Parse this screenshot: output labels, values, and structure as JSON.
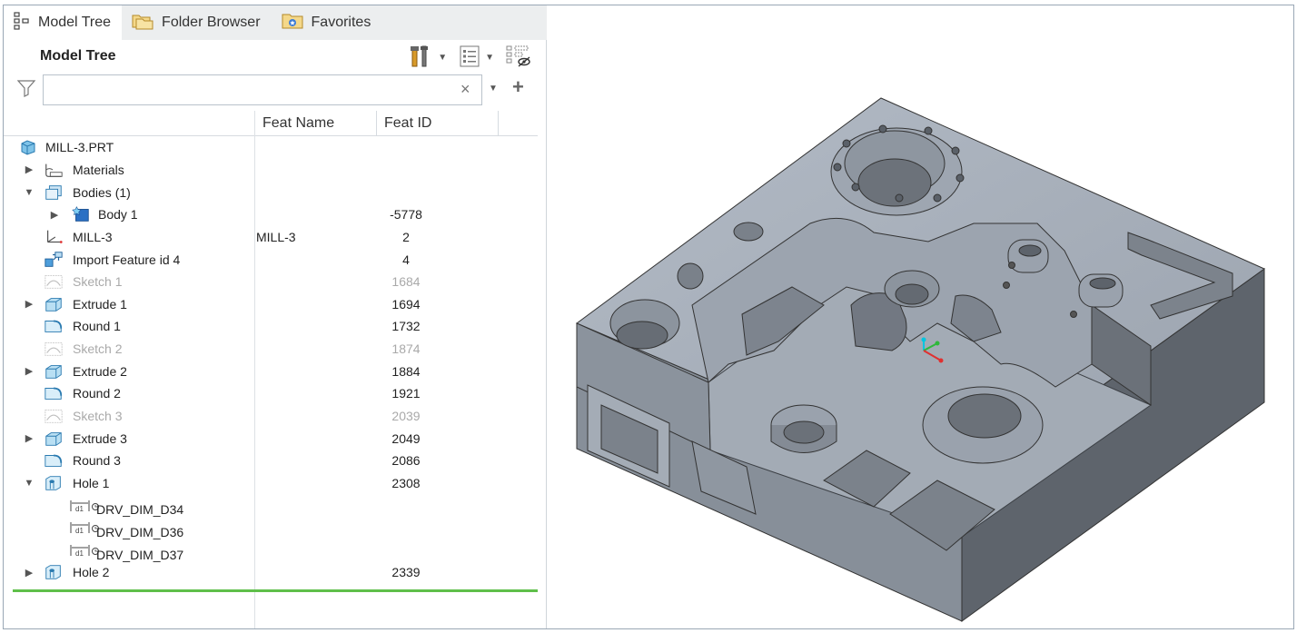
{
  "tabs": [
    {
      "label": "Model Tree",
      "icon": "model-tree-icon",
      "active": true
    },
    {
      "label": "Folder Browser",
      "icon": "folder-icon",
      "active": false
    },
    {
      "label": "Favorites",
      "icon": "favorites-icon",
      "active": false
    }
  ],
  "panel": {
    "title": "Model Tree",
    "search": {
      "value": "",
      "placeholder": ""
    },
    "clear_symbol": "×",
    "add_symbol": "+"
  },
  "columns": {
    "feat_name": "Feat Name",
    "feat_id": "Feat ID"
  },
  "tree": [
    {
      "label": "MILL-3.PRT",
      "icon": "part-icon",
      "indent": 0,
      "expander": "",
      "feat_name": "",
      "feat_id": "",
      "dim": false
    },
    {
      "label": "Materials",
      "icon": "materials-icon",
      "indent": 1,
      "expander": "▶",
      "feat_name": "",
      "feat_id": "",
      "dim": false
    },
    {
      "label": "Bodies (1)",
      "icon": "bodies-icon",
      "indent": 1,
      "expander": "▼",
      "feat_name": "",
      "feat_id": "",
      "dim": false
    },
    {
      "label": "Body 1",
      "icon": "body-icon",
      "indent": 2,
      "expander": "▶",
      "feat_name": "",
      "feat_id": "-5778",
      "dim": false
    },
    {
      "label": "MILL-3",
      "icon": "csys-icon",
      "indent": 1,
      "expander": "",
      "feat_name": "MILL-3",
      "feat_id": "2",
      "dim": false
    },
    {
      "label": "Import Feature id 4",
      "icon": "import-feature-icon",
      "indent": 1,
      "expander": "",
      "feat_name": "",
      "feat_id": "4",
      "dim": false
    },
    {
      "label": "Sketch 1",
      "icon": "sketch-icon",
      "indent": 1,
      "expander": "",
      "feat_name": "",
      "feat_id": "1684",
      "dim": true
    },
    {
      "label": "Extrude 1",
      "icon": "extrude-icon",
      "indent": 1,
      "expander": "▶",
      "feat_name": "",
      "feat_id": "1694",
      "dim": false
    },
    {
      "label": "Round 1",
      "icon": "round-icon",
      "indent": 1,
      "expander": "",
      "feat_name": "",
      "feat_id": "1732",
      "dim": false
    },
    {
      "label": "Sketch 2",
      "icon": "sketch-icon",
      "indent": 1,
      "expander": "",
      "feat_name": "",
      "feat_id": "1874",
      "dim": true
    },
    {
      "label": "Extrude 2",
      "icon": "extrude-icon",
      "indent": 1,
      "expander": "▶",
      "feat_name": "",
      "feat_id": "1884",
      "dim": false
    },
    {
      "label": "Round 2",
      "icon": "round-icon",
      "indent": 1,
      "expander": "",
      "feat_name": "",
      "feat_id": "1921",
      "dim": false
    },
    {
      "label": "Sketch 3",
      "icon": "sketch-icon",
      "indent": 1,
      "expander": "",
      "feat_name": "",
      "feat_id": "2039",
      "dim": true
    },
    {
      "label": "Extrude 3",
      "icon": "extrude-icon",
      "indent": 1,
      "expander": "▶",
      "feat_name": "",
      "feat_id": "2049",
      "dim": false
    },
    {
      "label": "Round 3",
      "icon": "round-icon",
      "indent": 1,
      "expander": "",
      "feat_name": "",
      "feat_id": "2086",
      "dim": false
    },
    {
      "label": "Hole 1",
      "icon": "hole-icon",
      "indent": 1,
      "expander": "▼",
      "feat_name": "",
      "feat_id": "2308",
      "dim": false
    },
    {
      "label": "DRV_DIM_D34",
      "icon": "dimension-relation-icon",
      "indent": 2,
      "expander": "",
      "feat_name": "",
      "feat_id": "",
      "dim": false
    },
    {
      "label": "DRV_DIM_D36",
      "icon": "dimension-relation-icon",
      "indent": 2,
      "expander": "",
      "feat_name": "",
      "feat_id": "",
      "dim": false
    },
    {
      "label": "DRV_DIM_D37",
      "icon": "dimension-relation-icon",
      "indent": 2,
      "expander": "",
      "feat_name": "",
      "feat_id": "",
      "dim": false
    },
    {
      "label": "Hole 2",
      "icon": "hole-icon",
      "indent": 1,
      "expander": "▶",
      "feat_name": "",
      "feat_id": "2339",
      "dim": false
    }
  ],
  "colors": {
    "model_face_top": "#a9b1bc",
    "model_face_left": "#8b939d",
    "model_face_right": "#5d636b",
    "insert_bar": "#5fbf4a"
  }
}
